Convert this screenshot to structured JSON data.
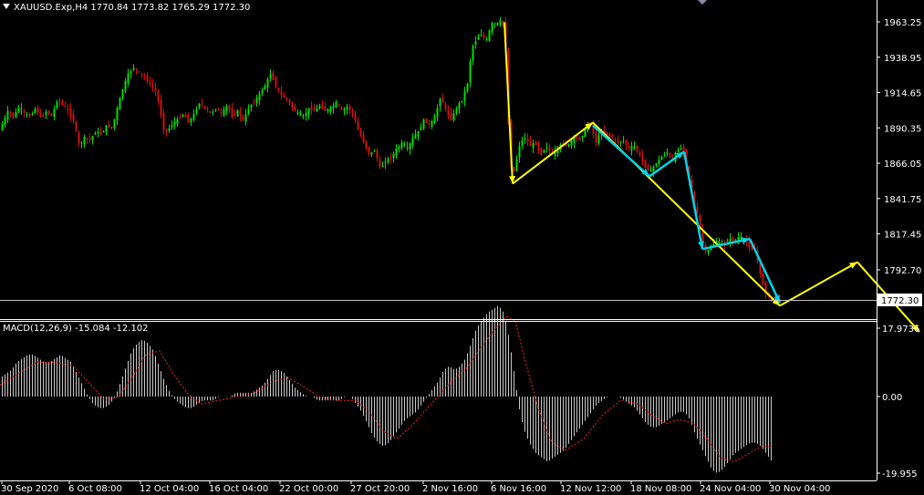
{
  "header": {
    "symbol": "XAUUSD.Exp,H4",
    "open": "1770.84",
    "high": "1773.82",
    "low": "1765.29",
    "close": "1772.30"
  },
  "macd": {
    "label": "MACD(12,26,9)",
    "main": "-15.084",
    "signal": "-12.102",
    "ticks": [
      "17.9736",
      "0.00",
      "-19.955"
    ]
  },
  "colors": {
    "background": "#000000",
    "bull": "#00e000",
    "bear": "#d01010",
    "wave_major": "#ffff00",
    "wave_minor": "#00d2e6",
    "price_line": "#c0c0c0",
    "macd_hist": "#c8c8c8",
    "macd_signal": "#ff2020"
  },
  "chart_data": {
    "type": "candlestick",
    "symbol": "XAUUSD.Exp",
    "timeframe": "H4",
    "y_ticks": [
      1963.25,
      1938.95,
      1914.65,
      1890.35,
      1866.05,
      1841.75,
      1817.45,
      1792.7
    ],
    "y_tick_labels": [
      "1963.25",
      "1938.95",
      "1914.65",
      "1890.35",
      "1866.05",
      "1841.75",
      "1817.45",
      "1792.70"
    ],
    "last_price": "1772.30",
    "x_tick_labels": [
      "30 Sep 2020",
      "6 Oct 08:00",
      "12 Oct 04:00",
      "16 Oct 04:00",
      "22 Oct 00:00",
      "27 Oct 20:00",
      "2 Nov 16:00",
      "6 Nov 16:00",
      "12 Nov 12:00",
      "18 Nov 08:00",
      "24 Nov 04:00",
      "30 Nov 04:00"
    ],
    "price_path": [
      [
        0,
        1888
      ],
      [
        5,
        1895
      ],
      [
        10,
        1902
      ],
      [
        16,
        1898
      ],
      [
        22,
        1905
      ],
      [
        28,
        1900
      ],
      [
        34,
        1898
      ],
      [
        40,
        1904
      ],
      [
        46,
        1897
      ],
      [
        52,
        1902
      ],
      [
        58,
        1898
      ],
      [
        64,
        1910
      ],
      [
        70,
        1906
      ],
      [
        76,
        1902
      ],
      [
        82,
        1895
      ],
      [
        88,
        1878
      ],
      [
        94,
        1884
      ],
      [
        100,
        1882
      ],
      [
        106,
        1888
      ],
      [
        112,
        1886
      ],
      [
        118,
        1892
      ],
      [
        124,
        1890
      ],
      [
        130,
        1905
      ],
      [
        136,
        1918
      ],
      [
        142,
        1928
      ],
      [
        148,
        1932
      ],
      [
        154,
        1928
      ],
      [
        160,
        1925
      ],
      [
        166,
        1920
      ],
      [
        172,
        1915
      ],
      [
        176,
        1905
      ],
      [
        180,
        1890
      ],
      [
        184,
        1888
      ],
      [
        190,
        1893
      ],
      [
        196,
        1896
      ],
      [
        202,
        1900
      ],
      [
        208,
        1894
      ],
      [
        214,
        1900
      ],
      [
        220,
        1908
      ],
      [
        226,
        1904
      ],
      [
        232,
        1900
      ],
      [
        238,
        1904
      ],
      [
        244,
        1900
      ],
      [
        250,
        1906
      ],
      [
        256,
        1898
      ],
      [
        262,
        1902
      ],
      [
        268,
        1895
      ],
      [
        274,
        1905
      ],
      [
        280,
        1908
      ],
      [
        286,
        1914
      ],
      [
        292,
        1920
      ],
      [
        298,
        1928
      ],
      [
        304,
        1918
      ],
      [
        310,
        1912
      ],
      [
        316,
        1910
      ],
      [
        322,
        1904
      ],
      [
        328,
        1900
      ],
      [
        334,
        1898
      ],
      [
        340,
        1904
      ],
      [
        346,
        1902
      ],
      [
        352,
        1906
      ],
      [
        358,
        1902
      ],
      [
        364,
        1904
      ],
      [
        370,
        1908
      ],
      [
        376,
        1902
      ],
      [
        382,
        1905
      ],
      [
        388,
        1900
      ],
      [
        394,
        1888
      ],
      [
        400,
        1880
      ],
      [
        406,
        1872
      ],
      [
        412,
        1875
      ],
      [
        418,
        1862
      ],
      [
        424,
        1868
      ],
      [
        430,
        1870
      ],
      [
        436,
        1876
      ],
      [
        442,
        1880
      ],
      [
        448,
        1876
      ],
      [
        454,
        1884
      ],
      [
        460,
        1888
      ],
      [
        466,
        1896
      ],
      [
        472,
        1892
      ],
      [
        478,
        1898
      ],
      [
        484,
        1912
      ],
      [
        490,
        1902
      ],
      [
        496,
        1896
      ],
      [
        502,
        1905
      ],
      [
        508,
        1910
      ],
      [
        514,
        1922
      ],
      [
        518,
        1945
      ],
      [
        522,
        1950
      ],
      [
        528,
        1955
      ],
      [
        534,
        1950
      ],
      [
        540,
        1962
      ],
      [
        546,
        1962
      ],
      [
        552,
        1965
      ],
      [
        556,
        1940
      ],
      [
        560,
        1865
      ],
      [
        565,
        1860
      ],
      [
        570,
        1878
      ],
      [
        576,
        1884
      ],
      [
        582,
        1878
      ],
      [
        588,
        1880
      ],
      [
        594,
        1872
      ],
      [
        600,
        1878
      ],
      [
        606,
        1872
      ],
      [
        612,
        1876
      ],
      [
        618,
        1880
      ],
      [
        624,
        1878
      ],
      [
        630,
        1884
      ],
      [
        636,
        1882
      ],
      [
        642,
        1888
      ],
      [
        648,
        1895
      ],
      [
        654,
        1880
      ],
      [
        660,
        1888
      ],
      [
        666,
        1886
      ],
      [
        672,
        1884
      ],
      [
        678,
        1880
      ],
      [
        684,
        1882
      ],
      [
        690,
        1876
      ],
      [
        696,
        1878
      ],
      [
        702,
        1872
      ],
      [
        708,
        1864
      ],
      [
        714,
        1860
      ],
      [
        720,
        1866
      ],
      [
        726,
        1870
      ],
      [
        732,
        1874
      ],
      [
        738,
        1868
      ],
      [
        744,
        1876
      ],
      [
        750,
        1876
      ],
      [
        754,
        1862
      ],
      [
        758,
        1850
      ],
      [
        762,
        1838
      ],
      [
        766,
        1830
      ],
      [
        770,
        1815
      ],
      [
        774,
        1805
      ],
      [
        778,
        1806
      ],
      [
        782,
        1810
      ],
      [
        788,
        1812
      ],
      [
        794,
        1810
      ],
      [
        800,
        1814
      ],
      [
        806,
        1812
      ],
      [
        812,
        1816
      ],
      [
        818,
        1812
      ],
      [
        824,
        1808
      ],
      [
        830,
        1805
      ],
      [
        834,
        1790
      ],
      [
        838,
        1782
      ],
      [
        842,
        1775
      ],
      [
        846,
        1772
      ]
    ],
    "waves_major": [
      [
        553,
        1963
      ],
      [
        562,
        1852
      ],
      [
        650,
        1894
      ],
      [
        855,
        1768
      ],
      [
        940,
        1798
      ]
    ],
    "wave_tail": [
      [
        940,
        1798
      ],
      [
        1008,
        1750
      ]
    ],
    "waves_minor": [
      [
        650,
        1892
      ],
      [
        712,
        1857
      ],
      [
        750,
        1874
      ],
      [
        770,
        1807
      ],
      [
        822,
        1814
      ],
      [
        855,
        1770
      ]
    ],
    "macd_main": [
      [
        0,
        5
      ],
      [
        6,
        6
      ],
      [
        12,
        7
      ],
      [
        18,
        9
      ],
      [
        24,
        10
      ],
      [
        30,
        11
      ],
      [
        36,
        11
      ],
      [
        42,
        10
      ],
      [
        48,
        9
      ],
      [
        54,
        9
      ],
      [
        60,
        10
      ],
      [
        66,
        11
      ],
      [
        72,
        10
      ],
      [
        78,
        9
      ],
      [
        84,
        6
      ],
      [
        90,
        3
      ],
      [
        96,
        0
      ],
      [
        102,
        -2
      ],
      [
        108,
        -3
      ],
      [
        114,
        -3
      ],
      [
        120,
        -2
      ],
      [
        126,
        0
      ],
      [
        132,
        4
      ],
      [
        138,
        8
      ],
      [
        144,
        12
      ],
      [
        150,
        14
      ],
      [
        156,
        15
      ],
      [
        162,
        14
      ],
      [
        168,
        12
      ],
      [
        174,
        8
      ],
      [
        180,
        4
      ],
      [
        186,
        1
      ],
      [
        192,
        -1
      ],
      [
        198,
        -2
      ],
      [
        204,
        -3
      ],
      [
        210,
        -3
      ],
      [
        216,
        -2
      ],
      [
        222,
        -1
      ],
      [
        228,
        -1
      ],
      [
        234,
        -1
      ],
      [
        240,
        0
      ],
      [
        246,
        0
      ],
      [
        252,
        0
      ],
      [
        258,
        1
      ],
      [
        264,
        1
      ],
      [
        270,
        1
      ],
      [
        276,
        1
      ],
      [
        282,
        2
      ],
      [
        288,
        3
      ],
      [
        294,
        5
      ],
      [
        300,
        7
      ],
      [
        306,
        7
      ],
      [
        312,
        6
      ],
      [
        318,
        4
      ],
      [
        324,
        2
      ],
      [
        330,
        1
      ],
      [
        336,
        0
      ],
      [
        342,
        0
      ],
      [
        348,
        -1
      ],
      [
        354,
        -1
      ],
      [
        360,
        -1
      ],
      [
        366,
        -1
      ],
      [
        372,
        -1
      ],
      [
        378,
        0
      ],
      [
        384,
        0
      ],
      [
        390,
        -2
      ],
      [
        396,
        -4
      ],
      [
        402,
        -7
      ],
      [
        408,
        -10
      ],
      [
        414,
        -12
      ],
      [
        420,
        -13
      ],
      [
        426,
        -12
      ],
      [
        432,
        -10
      ],
      [
        438,
        -8
      ],
      [
        444,
        -6
      ],
      [
        450,
        -5
      ],
      [
        456,
        -4
      ],
      [
        462,
        -2
      ],
      [
        468,
        0
      ],
      [
        474,
        2
      ],
      [
        480,
        4
      ],
      [
        486,
        7
      ],
      [
        492,
        8
      ],
      [
        498,
        7
      ],
      [
        504,
        8
      ],
      [
        510,
        10
      ],
      [
        516,
        14
      ],
      [
        522,
        18
      ],
      [
        528,
        20
      ],
      [
        534,
        22
      ],
      [
        540,
        23
      ],
      [
        546,
        24
      ],
      [
        552,
        22
      ],
      [
        558,
        15
      ],
      [
        564,
        5
      ],
      [
        570,
        -5
      ],
      [
        576,
        -10
      ],
      [
        582,
        -13
      ],
      [
        588,
        -15
      ],
      [
        594,
        -16
      ],
      [
        600,
        -17
      ],
      [
        606,
        -16
      ],
      [
        612,
        -15
      ],
      [
        618,
        -14
      ],
      [
        624,
        -12
      ],
      [
        630,
        -10
      ],
      [
        636,
        -8
      ],
      [
        642,
        -6
      ],
      [
        648,
        -4
      ],
      [
        654,
        -2
      ],
      [
        660,
        -1
      ],
      [
        666,
        0
      ],
      [
        672,
        0
      ],
      [
        678,
        0
      ],
      [
        684,
        -1
      ],
      [
        690,
        -2
      ],
      [
        696,
        -3
      ],
      [
        702,
        -5
      ],
      [
        708,
        -7
      ],
      [
        714,
        -8
      ],
      [
        720,
        -8
      ],
      [
        726,
        -7
      ],
      [
        732,
        -6
      ],
      [
        738,
        -5
      ],
      [
        744,
        -4
      ],
      [
        750,
        -4
      ],
      [
        756,
        -6
      ],
      [
        762,
        -10
      ],
      [
        768,
        -13
      ],
      [
        774,
        -16
      ],
      [
        780,
        -19
      ],
      [
        786,
        -20
      ],
      [
        792,
        -19
      ],
      [
        798,
        -17
      ],
      [
        804,
        -15
      ],
      [
        810,
        -14
      ],
      [
        816,
        -13
      ],
      [
        822,
        -12
      ],
      [
        828,
        -12
      ],
      [
        834,
        -13
      ],
      [
        840,
        -15
      ],
      [
        846,
        -17
      ]
    ],
    "macd_signal_path": [
      [
        0,
        3
      ],
      [
        20,
        6
      ],
      [
        40,
        9
      ],
      [
        60,
        9
      ],
      [
        80,
        8
      ],
      [
        100,
        3
      ],
      [
        115,
        -1
      ],
      [
        130,
        0
      ],
      [
        145,
        5
      ],
      [
        160,
        11
      ],
      [
        175,
        12
      ],
      [
        190,
        6
      ],
      [
        205,
        1
      ],
      [
        220,
        -2
      ],
      [
        240,
        -1
      ],
      [
        260,
        0
      ],
      [
        280,
        1
      ],
      [
        300,
        4
      ],
      [
        315,
        5
      ],
      [
        330,
        3
      ],
      [
        350,
        0
      ],
      [
        370,
        -1
      ],
      [
        390,
        -1
      ],
      [
        405,
        -4
      ],
      [
        420,
        -9
      ],
      [
        435,
        -11
      ],
      [
        450,
        -8
      ],
      [
        465,
        -4
      ],
      [
        480,
        0
      ],
      [
        495,
        4
      ],
      [
        510,
        7
      ],
      [
        525,
        12
      ],
      [
        540,
        17
      ],
      [
        555,
        21
      ],
      [
        565,
        20
      ],
      [
        575,
        10
      ],
      [
        590,
        -3
      ],
      [
        605,
        -12
      ],
      [
        620,
        -14
      ],
      [
        640,
        -11
      ],
      [
        660,
        -5
      ],
      [
        680,
        -1
      ],
      [
        700,
        -2
      ],
      [
        715,
        -5
      ],
      [
        730,
        -7
      ],
      [
        745,
        -6
      ],
      [
        760,
        -7
      ],
      [
        775,
        -11
      ],
      [
        790,
        -16
      ],
      [
        805,
        -17
      ],
      [
        820,
        -15
      ],
      [
        835,
        -13
      ],
      [
        846,
        -13
      ]
    ]
  }
}
